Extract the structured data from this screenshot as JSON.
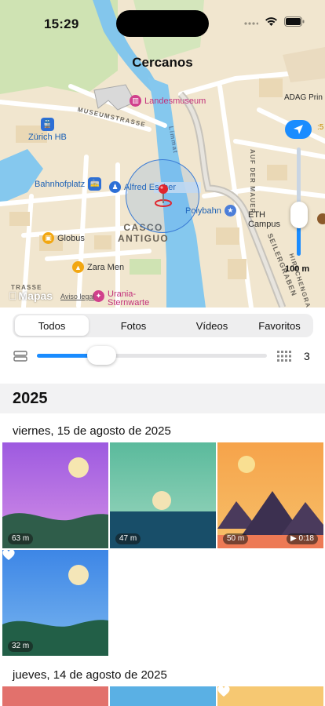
{
  "status": {
    "time": "15:29"
  },
  "map": {
    "title": "Cercanos",
    "labels": {
      "landesmuseum": "Landesmuseum",
      "adag": "ADAG Prin",
      "zurich_hb": "Zürich HB",
      "bahnhofplatz": "Bahnhofplatz",
      "alfred_escher": "Alfred Escher",
      "polybahn": "Polybahn",
      "eth_campus": "ETH\nCampus",
      "globus": "Globus",
      "zara": "Zara Men",
      "urania": "Urania-\nSternwarte",
      "museumstrasse": "MUSEUMSTRASSE",
      "limmat": "Limmat",
      "auf_der_mauer": "AUF DER MAUER",
      "seilergraben": "SEILERGRABEN",
      "hirschengraben": "HIRSCHENGRAB",
      "casco_antiguo": "CASCO\nANTIGUO",
      "trasse": "TRASSE",
      "stray_5": ":5"
    },
    "zoom_label": "100 m",
    "zoom_level": 0.28,
    "attribution": "Mapas",
    "legal": "Aviso legal"
  },
  "filter": {
    "segments": [
      "Todos",
      "Fotos",
      "Vídeos",
      "Favoritos"
    ],
    "selected": "Todos",
    "slider_value": 0.28,
    "grid_count": "3"
  },
  "gallery": {
    "year": "2025",
    "groups": [
      {
        "date": "viernes, 15 de agosto de 2025",
        "items": [
          {
            "distance": "63 m",
            "favorite": false
          },
          {
            "distance": "47 m",
            "favorite": false
          },
          {
            "distance": "50 m",
            "duration": "0:18",
            "favorite": false
          },
          {
            "distance": "32 m",
            "favorite": true
          }
        ]
      },
      {
        "date": "jueves, 14 de agosto de 2025",
        "items": [
          {
            "favorite": false
          },
          {
            "favorite": false
          },
          {
            "favorite": true
          }
        ]
      }
    ]
  },
  "colors": {
    "accent": "#1a8cff",
    "pin": "#e0252d"
  }
}
